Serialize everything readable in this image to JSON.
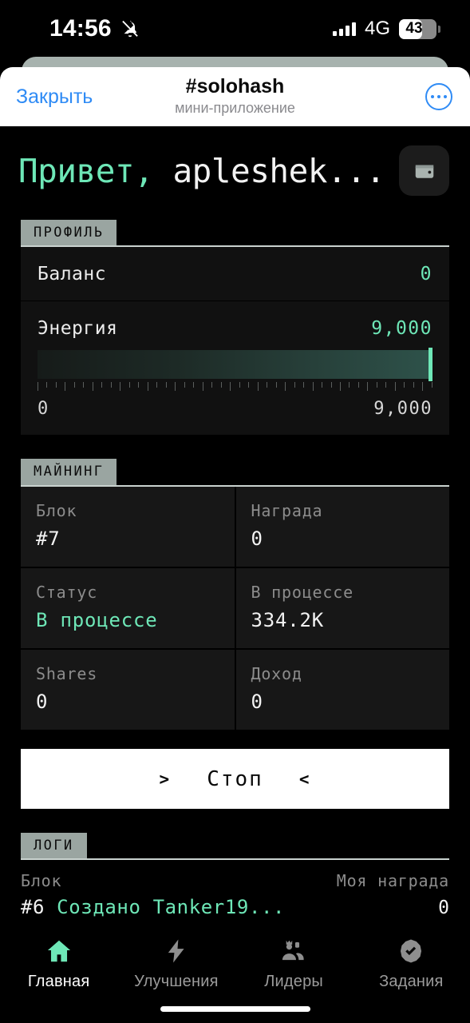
{
  "status_bar": {
    "time": "14:56",
    "bell_icon": "bell-muted-icon",
    "network": "4G",
    "battery_percent": "43",
    "signal_icon": "signal-bars-icon"
  },
  "telegram_header": {
    "close_label": "Закрыть",
    "title": "#solohash",
    "subtitle": "мини-приложение",
    "more_icon": "more-dots-icon"
  },
  "greeting": {
    "hello": "Привет,",
    "username": "apleshek...",
    "wallet_icon": "wallet-icon"
  },
  "profile": {
    "section_label": "ПРОФИЛЬ",
    "balance_label": "Баланс",
    "balance_value": "0",
    "energy_label": "Энергия",
    "energy_value": "9,000",
    "energy_min": "0",
    "energy_max": "9,000",
    "energy_percent": 100
  },
  "mining": {
    "section_label": "МАЙНИНГ",
    "cells": [
      {
        "label": "Блок",
        "value": "#7",
        "accent": false
      },
      {
        "label": "Награда",
        "value": "0",
        "accent": false
      },
      {
        "label": "Статус",
        "value": "В процессе",
        "accent": true
      },
      {
        "label": "В процессе",
        "value": "334.2K",
        "accent": false
      },
      {
        "label": "Shares",
        "value": "0",
        "accent": false
      },
      {
        "label": "Доход",
        "value": "0",
        "accent": false
      }
    ],
    "action_label": "Стоп",
    "action_left_chevron": ">",
    "action_right_chevron": "<"
  },
  "logs": {
    "section_label": "ЛОГИ",
    "col_block": "Блок",
    "col_reward": "Моя награда",
    "rows": [
      {
        "block": "#6",
        "message": "Создано Tanker19...",
        "reward": "0"
      },
      {
        "block": "",
        "message": "",
        "reward": ""
      }
    ]
  },
  "bottom_nav": {
    "items": [
      {
        "label": "Главная",
        "icon": "home-icon",
        "active": true
      },
      {
        "label": "Улучшения",
        "icon": "lightning-icon",
        "active": false
      },
      {
        "label": "Лидеры",
        "icon": "leaderboard-icon",
        "active": false
      },
      {
        "label": "Задания",
        "icon": "badge-check-icon",
        "active": false
      }
    ]
  },
  "colors": {
    "accent_mint": "#6ee7b7",
    "background": "#000000",
    "card": "#111111",
    "cell": "#171717",
    "tab_grey": "#9aa5a1",
    "tg_blue": "#2f8bf5"
  }
}
